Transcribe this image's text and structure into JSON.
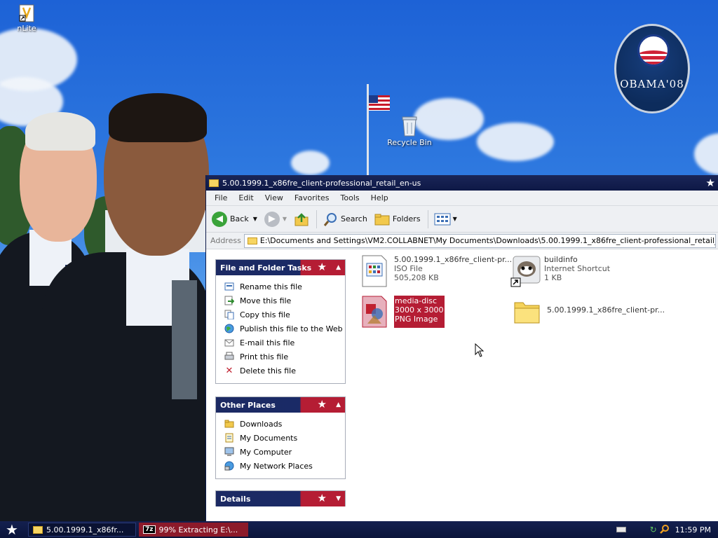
{
  "desktop": {
    "icons": [
      {
        "label": "nLite"
      },
      {
        "label": "Recycle Bin"
      }
    ],
    "logo_text": "OBAMA'08"
  },
  "window": {
    "title": "5.00.1999.1_x86fre_client-professional_retail_en-us",
    "menu": [
      "File",
      "Edit",
      "View",
      "Favorites",
      "Tools",
      "Help"
    ],
    "toolbar": {
      "back_label": "Back",
      "search_label": "Search",
      "folders_label": "Folders"
    },
    "address": {
      "label": "Address",
      "value": "E:\\Documents and Settings\\VM2.COLLABNET\\My Documents\\Downloads\\5.00.1999.1_x86fre_client-professional_retail_en-us"
    },
    "panels": {
      "file_tasks": {
        "title": "File and Folder Tasks",
        "items": [
          "Rename this file",
          "Move this file",
          "Copy this file",
          "Publish this file to the Web",
          "E-mail this file",
          "Print this file",
          "Delete this file"
        ]
      },
      "other_places": {
        "title": "Other Places",
        "items": [
          "Downloads",
          "My Documents",
          "My Computer",
          "My Network Places"
        ]
      },
      "details": {
        "title": "Details"
      }
    },
    "files": [
      {
        "name": "5.00.1999.1_x86fre_client-pr...",
        "type": "ISO File",
        "size": "505,208 KB"
      },
      {
        "name": "buildinfo",
        "type": "Internet Shortcut",
        "size": "1 KB"
      },
      {
        "name": "media-disc",
        "type": "3000 x 3000",
        "size": "PNG Image"
      },
      {
        "name": "5.00.1999.1_x86fre_client-pr...",
        "type": "",
        "size": ""
      }
    ]
  },
  "taskbar": {
    "buttons": [
      "5.00.1999.1_x86fr...",
      "99% Extracting E:\\..."
    ],
    "zip_badge": "7z",
    "clock": "11:59 PM"
  },
  "colors": {
    "panel_navy": "#1c2a63",
    "panel_red": "#b51d34",
    "titlebar": "#0e1846"
  }
}
